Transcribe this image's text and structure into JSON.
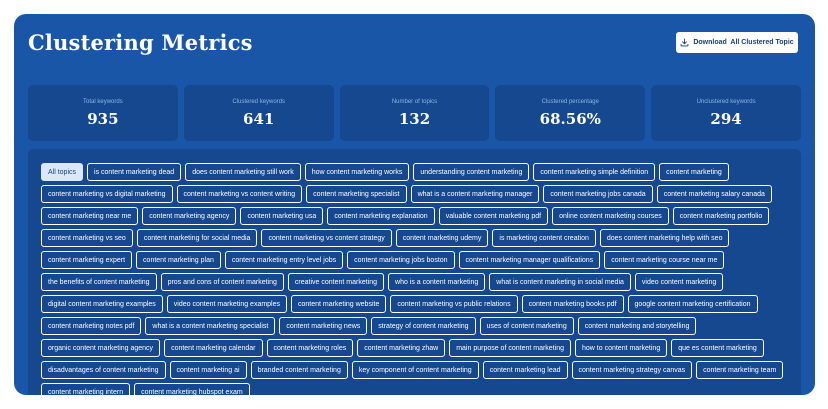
{
  "header": {
    "title": "Clustering Metrics",
    "download_label": "Download  All Clustered Topic"
  },
  "stats": [
    {
      "label": "Total keywords",
      "value": "935"
    },
    {
      "label": "Clustered keywords",
      "value": "641"
    },
    {
      "label": "Number of topics",
      "value": "132"
    },
    {
      "label": "Clustered percentage",
      "value": "68.56%"
    },
    {
      "label": "Unclustered keywords",
      "value": "294"
    }
  ],
  "topics": {
    "active": "All topics",
    "items": [
      "All topics",
      "is content marketing dead",
      "does content marketing still work",
      "how content marketing works",
      "understanding content marketing",
      "content marketing simple definition",
      "content marketing",
      "content marketing vs digital marketing",
      "content marketing vs content writing",
      "content marketing specialist",
      "what is a content marketing manager",
      "content marketing jobs canada",
      "content marketing salary canada",
      "content marketing near me",
      "content marketing agency",
      "content marketing usa",
      "content marketing explanation",
      "valuable content marketing pdf",
      "online content marketing courses",
      "content marketing portfolio",
      "content marketing vs seo",
      "content marketing for social media",
      "content marketing vs content strategy",
      "content marketing udemy",
      "is marketing content creation",
      "does content marketing help with seo",
      "content marketing expert",
      "content marketing plan",
      "content marketing entry level jobs",
      "content marketing jobs boston",
      "content marketing manager qualifications",
      "content marketing course near me",
      "the benefits of content marketing",
      "pros and cons of content marketing",
      "creative content marketing",
      "who is a content marketing",
      "what is content marketing in social media",
      "video content marketing",
      "digital content marketing examples",
      "video content marketing examples",
      "content marketing website",
      "content marketing vs public relations",
      "content marketing books pdf",
      "google content marketing certification",
      "content marketing notes pdf",
      "what is a content marketing specialist",
      "content marketing news",
      "strategy of content marketing",
      "uses of content marketing",
      "content marketing and storytelling",
      "organic content marketing agency",
      "content marketing calendar",
      "content marketing roles",
      "content marketing zhaw",
      "main purpose of content marketing",
      "how to content marketing",
      "que es content marketing",
      "disadvantages of content marketing",
      "content marketing ai",
      "branded content marketing",
      "key component of content marketing",
      "content marketing lead",
      "content marketing strategy canvas",
      "content marketing team",
      "content marketing intern",
      "content marketing hubspot exam"
    ]
  },
  "colors": {
    "background": "#1a56a8",
    "panel": "#15488f",
    "active_chip": "#dbe8fb"
  }
}
